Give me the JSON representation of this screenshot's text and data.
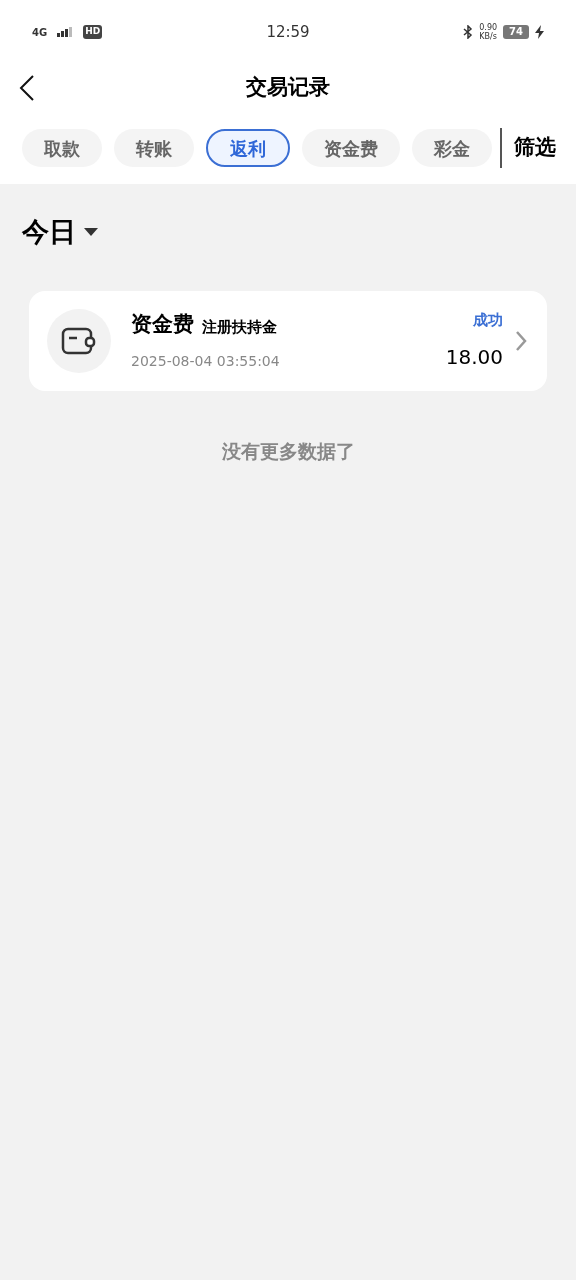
{
  "status_bar": {
    "network": "4G",
    "hd": "HD",
    "time": "12:59",
    "speed_value": "0.90",
    "speed_unit": "KB/s",
    "battery": "74"
  },
  "header": {
    "title": "交易记录"
  },
  "tabs": [
    {
      "label": "取款",
      "selected": false
    },
    {
      "label": "转账",
      "selected": false
    },
    {
      "label": "返利",
      "selected": true
    },
    {
      "label": "资金费",
      "selected": false
    },
    {
      "label": "彩金",
      "selected": false
    }
  ],
  "filter": "筛选",
  "date_filter": "今日",
  "records": [
    {
      "type": "资金费",
      "note": "注册扶持金",
      "time": "2025-08-04 03:55:04",
      "status": "成功",
      "amount": "18.00"
    }
  ],
  "end_message": "没有更多数据了"
}
